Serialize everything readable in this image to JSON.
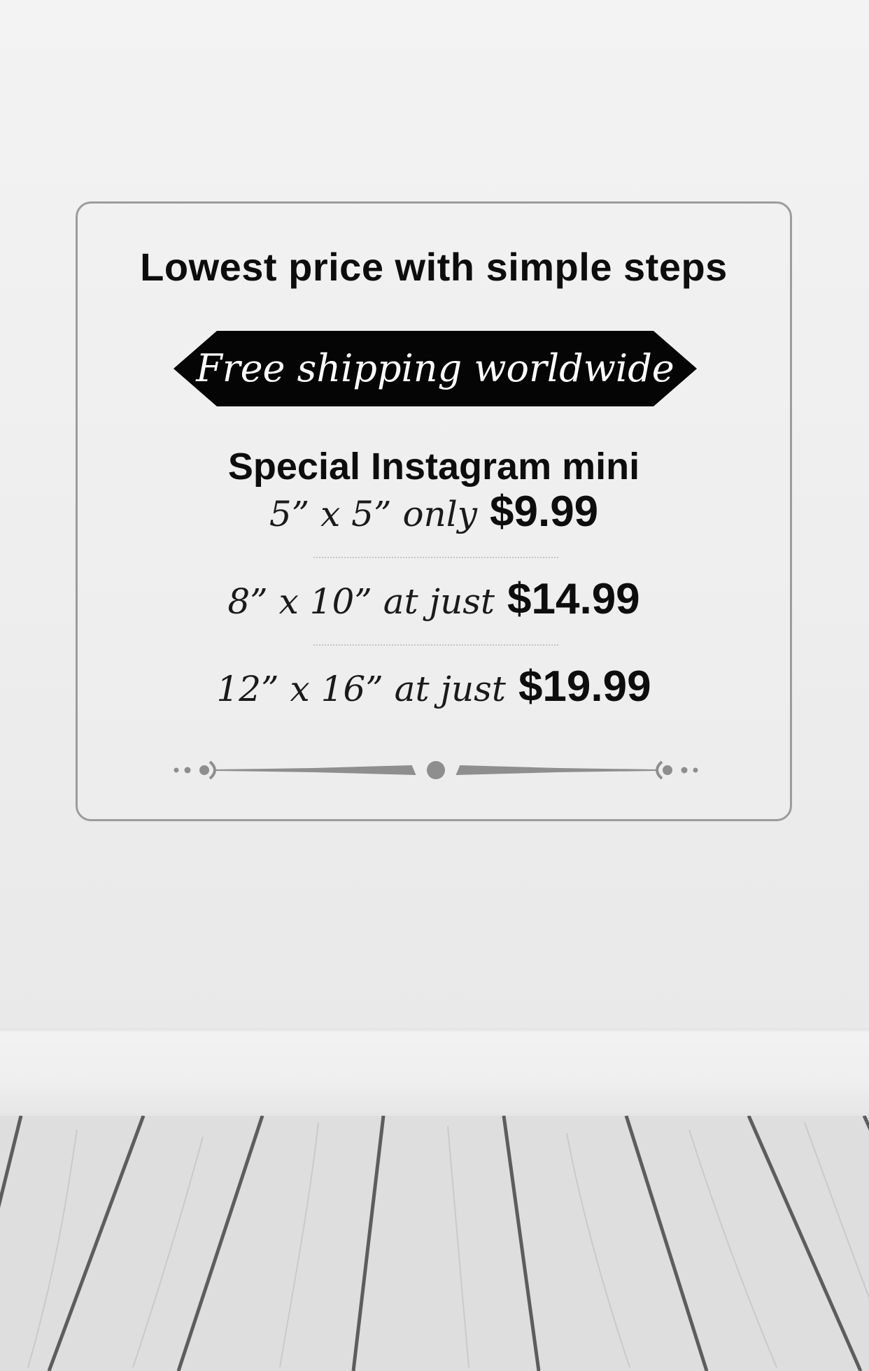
{
  "card": {
    "headline": "Lowest price with simple steps",
    "ribbon_text": "Free shipping worldwide",
    "special_title": "Special Instagram mini",
    "offers": [
      {
        "size": "5” x 5” only",
        "price": "$9.99"
      },
      {
        "size": "8” x 10” at just",
        "price": "$14.99"
      },
      {
        "size": "12” x 16” at just",
        "price": "$19.99"
      }
    ]
  },
  "colors": {
    "text": "#0d0d0d",
    "ribbon": "#050505",
    "ribbon_text": "#ffffff",
    "card_border": "#9c9c9c",
    "ornament": "#8e8e8e"
  },
  "icons": {
    "ribbon": "banner-ribbon-shape",
    "ornament": "decorative-flourish-divider"
  }
}
